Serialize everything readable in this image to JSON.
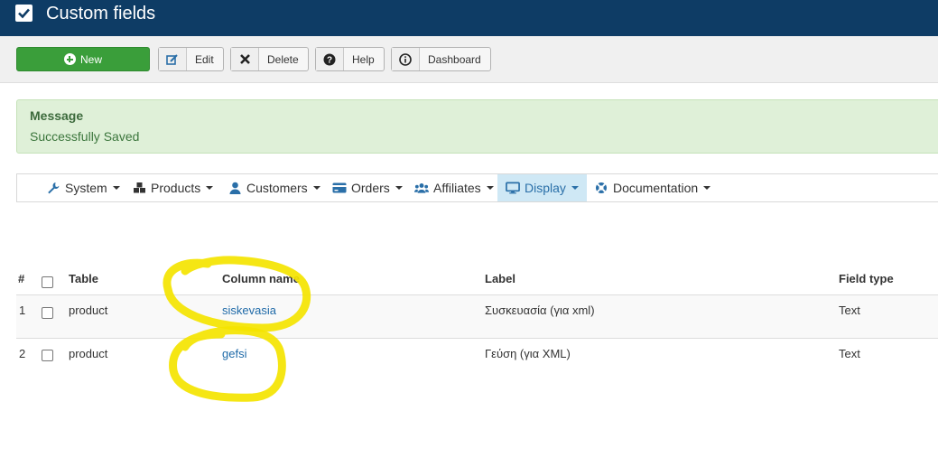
{
  "header": {
    "title": "Custom fields"
  },
  "toolbar": {
    "new_label": "New",
    "edit_label": "Edit",
    "delete_label": "Delete",
    "help_label": "Help",
    "dashboard_label": "Dashboard"
  },
  "message": {
    "heading": "Message",
    "text": "Successfully Saved"
  },
  "nav": {
    "items": [
      {
        "label": "System"
      },
      {
        "label": "Products"
      },
      {
        "label": "Customers"
      },
      {
        "label": "Orders"
      },
      {
        "label": "Affiliates"
      },
      {
        "label": "Display",
        "active": true
      },
      {
        "label": "Documentation"
      }
    ]
  },
  "table": {
    "headers": {
      "num": "#",
      "table": "Table",
      "column": "Column name",
      "label": "Label",
      "type": "Field type"
    },
    "rows": [
      {
        "num": "1",
        "table": "product",
        "column": "siskevasia",
        "label": "Συσκευασία (για xml)",
        "type": "Text"
      },
      {
        "num": "2",
        "table": "product",
        "column": "gefsi",
        "label": "Γεύση (για XML)",
        "type": "Text"
      }
    ]
  },
  "colors": {
    "header_bg": "#0e3c65",
    "new_button": "#3a9e3a",
    "message_bg": "#dff0d8",
    "active_nav": "#cfe8f5",
    "link": "#1f6aa8",
    "highlighter": "#f4e400"
  }
}
